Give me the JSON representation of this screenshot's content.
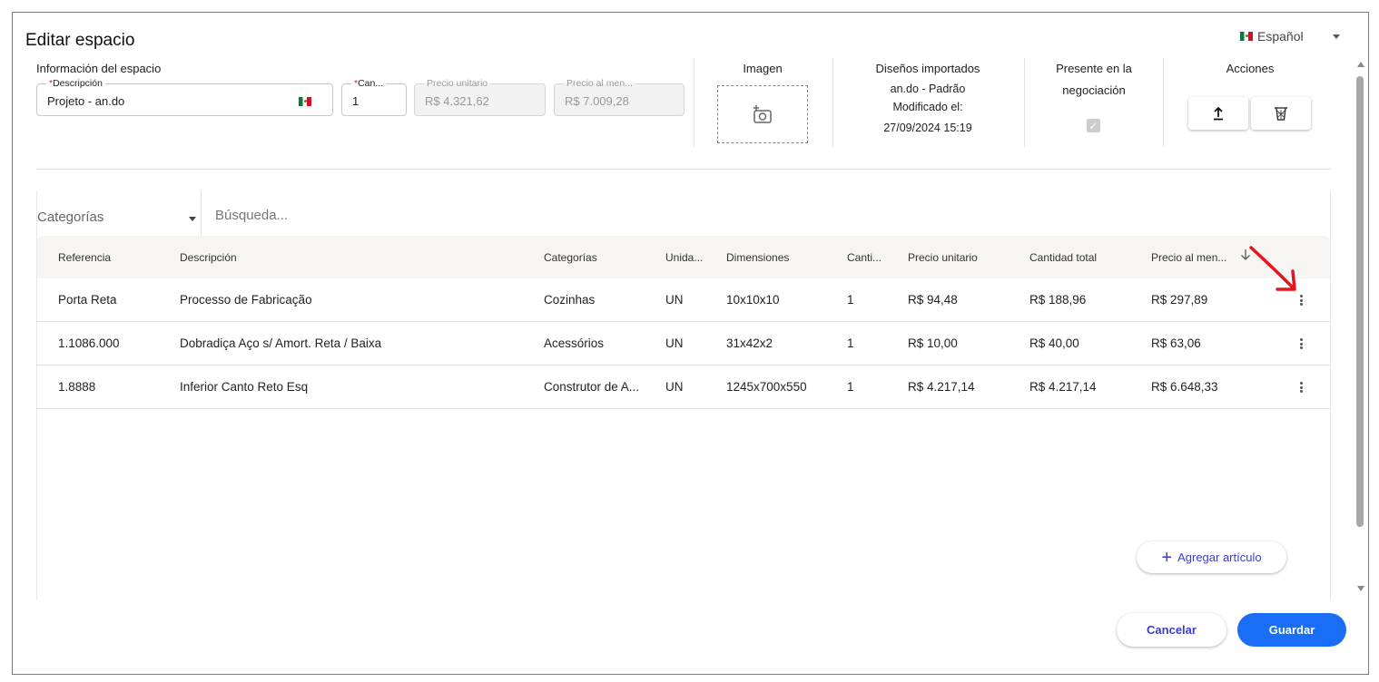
{
  "dialog": {
    "title": "Editar espacio",
    "language": "Español",
    "language_flag_icon": "mexico-flag-icon"
  },
  "info": {
    "section_label": "Información del espacio",
    "description": {
      "label": "Descripción",
      "value": "Projeto - an.do"
    },
    "quantity": {
      "label": "Can...",
      "value": "1"
    },
    "unit_price": {
      "label": "Precio unitario",
      "value": "R$ 4.321,62"
    },
    "retail_price": {
      "label": "Precio al men...",
      "value": "R$ 7.009,28"
    }
  },
  "image": {
    "heading": "Imagen",
    "icon": "add-photo-icon"
  },
  "designs": {
    "heading": "Diseños importados",
    "name": "an.do - Padrão",
    "modified_label": "Modificado el:",
    "modified_value": "27/09/2024 15:19"
  },
  "negotiation": {
    "heading_line1": "Presente en la",
    "heading_line2": "negociación",
    "checked": true
  },
  "actions": {
    "heading": "Acciones",
    "upload_icon": "upload-icon",
    "delete_icon": "trash-icon"
  },
  "filter": {
    "category_placeholder": "Categorías",
    "search_placeholder": "Búsqueda..."
  },
  "table": {
    "columns": [
      "Referencia",
      "Descripción",
      "Categorías",
      "Unida...",
      "Dimensiones",
      "Canti...",
      "Precio unitario",
      "Cantidad total",
      "Precio al men..."
    ],
    "sort_icon": "arrow-down-icon",
    "rows": [
      [
        "Porta Reta",
        "Processo de Fabricação",
        "Cozinhas",
        "UN",
        "10x10x10",
        "1",
        "R$ 94,48",
        "R$ 188,96",
        "R$ 297,89"
      ],
      [
        "1.1086.000",
        "Dobradiça Aço s/ Amort. Reta / Baixa",
        "Acessórios",
        "UN",
        "31x42x2",
        "1",
        "R$ 10,00",
        "R$ 40,00",
        "R$ 63,06"
      ],
      [
        "1.8888",
        "Inferior Canto Reto Esq",
        "Construtor de A...",
        "UN",
        "1245x700x550",
        "1",
        "R$ 4.217,14",
        "R$ 4.217,14",
        "R$ 6.648,33"
      ]
    ]
  },
  "buttons": {
    "add_item": "Agregar artículo",
    "cancel": "Cancelar",
    "save": "Guardar"
  },
  "colors": {
    "primary": "#1a6ef5",
    "link": "#3b3bd6",
    "annotation_arrow": "#e8141b"
  }
}
